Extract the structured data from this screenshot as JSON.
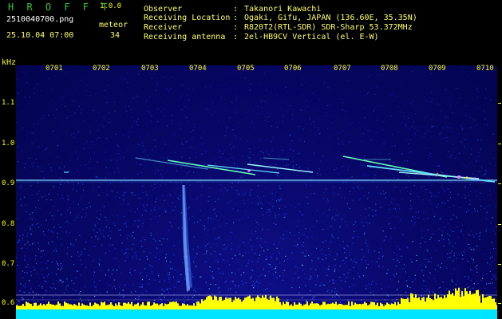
{
  "header": {
    "app_title": "H R O F F T",
    "app_version": "1.0.0",
    "file_name": "2510040700.png",
    "date_time": "25.10.04 07:00",
    "meteor_label": "meteor",
    "meteor_count": "34"
  },
  "info": [
    {
      "label": "Observer",
      "value": "Takanori Kawachi"
    },
    {
      "label": "Receiving Location",
      "value": "Ogaki, Gifu, JAPAN (136.60E, 35.35N)"
    },
    {
      "label": "Receiver",
      "value": "R820T2(RTL-SDR) SDR-Sharp 53.372MHz"
    },
    {
      "label": "Receiving antenna",
      "value": "2el-HB9CV Vertical (el. E-W)"
    }
  ],
  "axes": {
    "y_unit": "kHz",
    "y_ticks": [
      "1.1",
      "1.0",
      "0.9",
      "0.8",
      "0.7",
      "0.6"
    ],
    "x_ticks": [
      "0701",
      "0702",
      "0703",
      "0704",
      "0705",
      "0706",
      "0707",
      "0708",
      "0709",
      "0710"
    ]
  },
  "colors": {
    "title": "#33cc33",
    "version": "#ffff00",
    "white_text": "#ffffff",
    "yellow_text": "#ffff66",
    "axis_text": "#ffff00",
    "plot_bg": "#06065e",
    "signal_line": "#66ddff",
    "meteor_head": "#ff88ff",
    "noise_floor": "#ffff00",
    "floor_cyan": "#00e5ff"
  }
}
